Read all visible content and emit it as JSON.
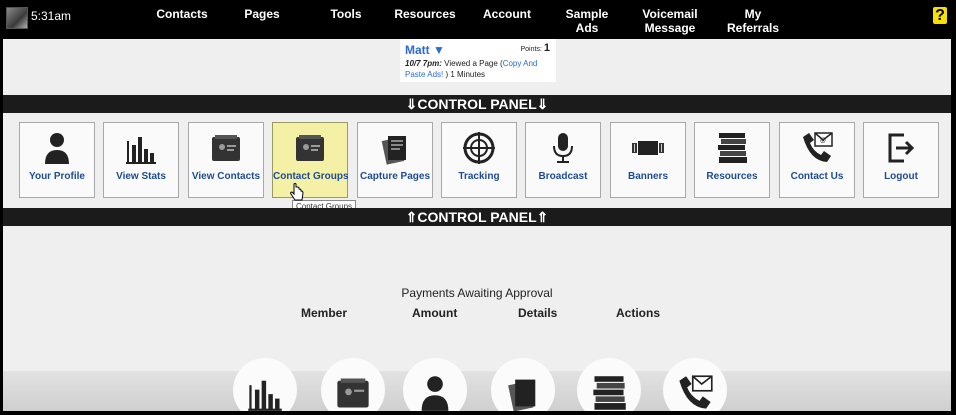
{
  "topbar": {
    "time": "5:31am",
    "nav": [
      {
        "id": "contacts",
        "label": "Contacts",
        "lines": [
          "Contacts"
        ]
      },
      {
        "id": "pages",
        "label": "Pages",
        "lines": [
          "Pages"
        ]
      },
      {
        "id": "tools",
        "label": "Tools",
        "lines": [
          "Tools"
        ]
      },
      {
        "id": "resources",
        "label": "Resources",
        "lines": [
          "Resources"
        ]
      },
      {
        "id": "account",
        "label": "Account",
        "lines": [
          "Account"
        ]
      },
      {
        "id": "sample-ads",
        "label": "Sample Ads",
        "lines": [
          "Sample",
          "Ads"
        ]
      },
      {
        "id": "voicemail-message",
        "label": "Voicemail Message",
        "lines": [
          "Voicemail",
          "Message"
        ]
      },
      {
        "id": "my-referrals",
        "label": "My Referrals",
        "lines": [
          "My",
          "Referrals"
        ]
      }
    ],
    "help": "?"
  },
  "notification": {
    "user": "Matt ▼",
    "points_label": "Points:",
    "points_value": "1",
    "time": "10/7 7pm:",
    "text": " Viewed a Page (",
    "link": "Copy And Paste Ads!",
    "suffix": " ) 1 Minutes"
  },
  "control_panel": {
    "top_label": "⇓CONTROL PANEL⇓",
    "bottom_label": "⇑CONTROL PANEL⇑",
    "tiles": [
      {
        "id": "your-profile",
        "label": "Your Profile",
        "icon": "person-icon"
      },
      {
        "id": "view-stats",
        "label": "View Stats",
        "icon": "bar-chart-icon"
      },
      {
        "id": "view-contacts",
        "label": "View Contacts",
        "icon": "card-file-icon"
      },
      {
        "id": "contact-groups",
        "label": "Contact Groups",
        "icon": "card-file-icon"
      },
      {
        "id": "capture-pages",
        "label": "Capture Pages",
        "icon": "pages-stack-icon"
      },
      {
        "id": "tracking",
        "label": "Tracking",
        "icon": "crosshair-icon"
      },
      {
        "id": "broadcast",
        "label": "Broadcast",
        "icon": "microphone-icon"
      },
      {
        "id": "banners",
        "label": "Banners",
        "icon": "banner-icon"
      },
      {
        "id": "resources",
        "label": "Resources",
        "icon": "books-icon"
      },
      {
        "id": "contact-us",
        "label": "Contact Us",
        "icon": "phone-mail-icon"
      },
      {
        "id": "logout",
        "label": "Logout",
        "icon": "logout-icon"
      }
    ],
    "active_tile": "contact-groups",
    "tooltip": "Contact Groups"
  },
  "payments": {
    "title": "Payments Awaiting Approval",
    "columns": [
      "Member",
      "Amount",
      "Details",
      "Actions"
    ]
  },
  "bottom_icons": [
    "bar-chart-icon",
    "card-file-icon",
    "person-icon",
    "pages-stack-icon",
    "books-icon",
    "phone-mail-icon"
  ],
  "colors": {
    "accent": "#1d4c95",
    "link": "#2a6bd6",
    "active_tile": "#f4f0a6",
    "bar": "#1b1b1b"
  }
}
